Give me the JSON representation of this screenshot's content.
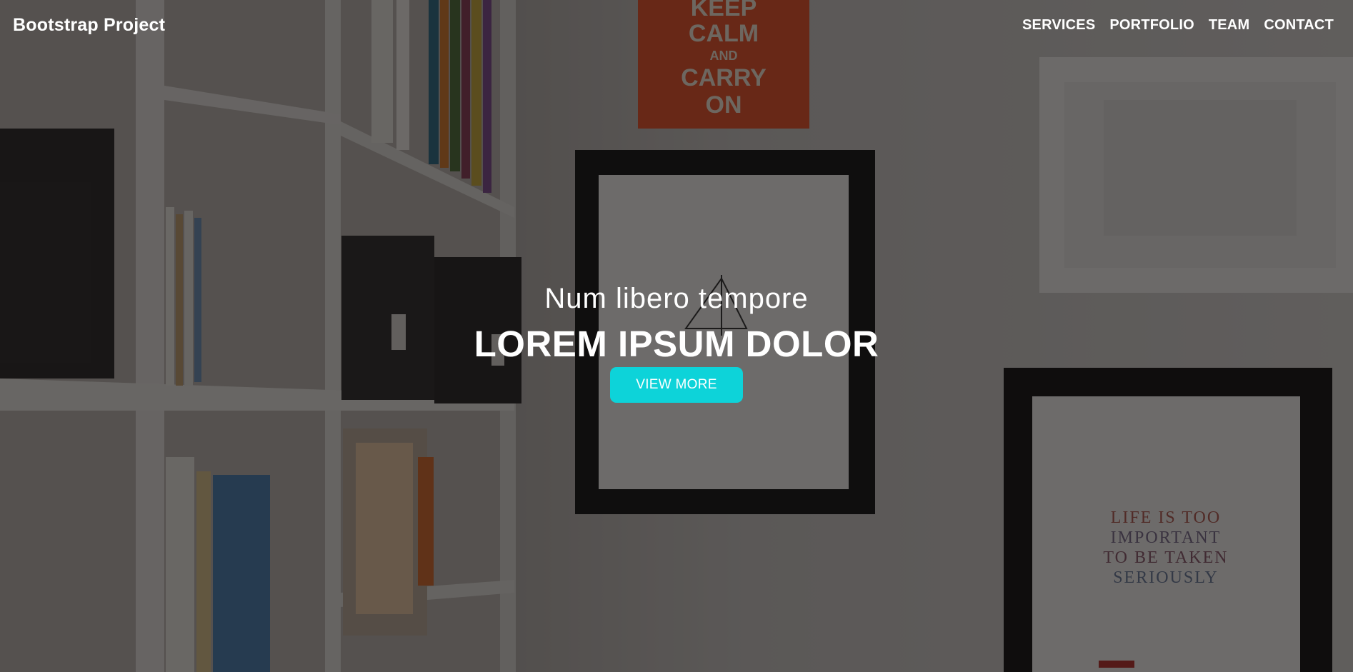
{
  "navbar": {
    "brand": "Bootstrap Project",
    "links": [
      {
        "label": "SERVICES"
      },
      {
        "label": "PORTFOLIO"
      },
      {
        "label": "TEAM"
      },
      {
        "label": "CONTACT"
      }
    ]
  },
  "hero": {
    "subtitle": "Num libero tempore",
    "title": "LOREM IPSUM DOLOR",
    "button_label": "VIEW MORE",
    "accent_color": "#0dd3d9"
  },
  "background_art": {
    "poster_text": [
      "KEEP",
      "CALM",
      "AND",
      "CARRY",
      "ON"
    ],
    "frame_quote_lines": [
      "LIFE IS TOO",
      "IMPORTANT",
      "TO BE TAKEN",
      "SERIOUSLY"
    ]
  }
}
